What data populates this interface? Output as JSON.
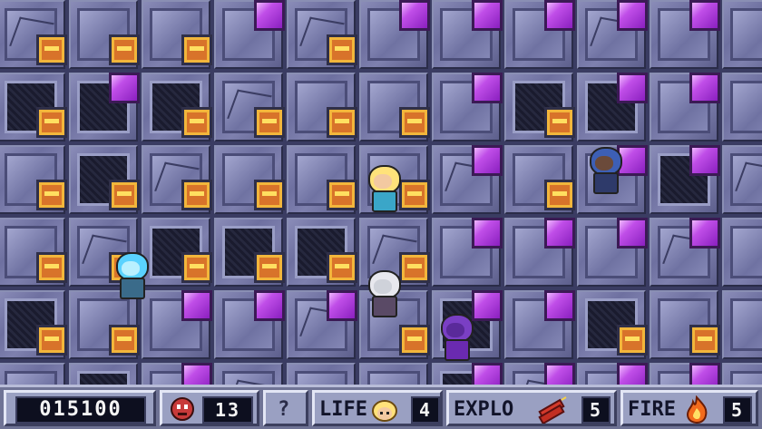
{
  "hud": {
    "score": "015100",
    "enemies_label_icon": "enemy-face-icon",
    "enemies": "13",
    "mystery": "?",
    "life_label": "LIFE",
    "life_icon": "hero-face-icon",
    "life": "4",
    "explo_label": "EXPLO",
    "explo_icon": "dynamite-icon",
    "explo": "5",
    "fire_label": "FIRE",
    "fire_icon": "flame-icon",
    "fire": "5"
  },
  "colors": {
    "brick": "#d8732a",
    "crystal": "#b04ae0",
    "floor": "#7e80ae",
    "hud": "#9aa0c2"
  }
}
